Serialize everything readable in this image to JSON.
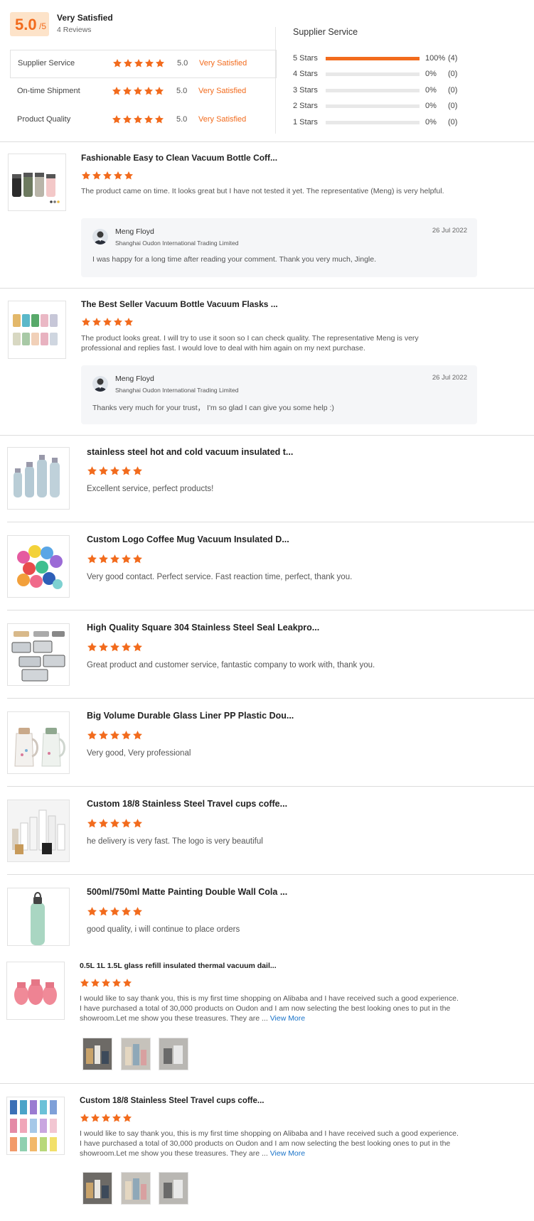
{
  "summary": {
    "score": "5.0",
    "score_max": "/5",
    "overall_label": "Very Satisfied",
    "review_count": "4 Reviews",
    "categories": [
      {
        "label": "Supplier Service",
        "rating": 5,
        "value": "5.0",
        "text": "Very Satisfied"
      },
      {
        "label": "On-time Shipment",
        "rating": 5,
        "value": "5.0",
        "text": "Very Satisfied"
      },
      {
        "label": "Product Quality",
        "rating": 5,
        "value": "5.0",
        "text": "Very Satisfied"
      }
    ],
    "distribution_title": "Supplier Service",
    "distribution": [
      {
        "label": "5 Stars",
        "percent": "100%",
        "count": "(4)",
        "fraction": 1.0
      },
      {
        "label": "4 Stars",
        "percent": "0%",
        "count": "(0)",
        "fraction": 0
      },
      {
        "label": "3 Stars",
        "percent": "0%",
        "count": "(0)",
        "fraction": 0
      },
      {
        "label": "2 Stars",
        "percent": "0%",
        "count": "(0)",
        "fraction": 0
      },
      {
        "label": "1 Stars",
        "percent": "0%",
        "count": "(0)",
        "fraction": 0
      }
    ]
  },
  "reviews": [
    {
      "title": "Fashionable Easy to Clean Vacuum Bottle Coff...",
      "rating": 5,
      "text": "The product came on time. It looks great but I have not tested it yet. The representative (Meng) is very helpful.",
      "reply": {
        "name": "Meng Floyd",
        "company": "Shanghai Oudon International Trading Limited",
        "date": "26 Jul 2022",
        "text": "I was happy for a long time after reading your comment. Thank you very much, Jingle."
      }
    },
    {
      "title": "The Best Seller Vacuum Bottle Vacuum Flasks ...",
      "rating": 5,
      "text": "The product looks great. I will try to use it soon so I can check quality. The representative Meng is very professional and replies fast. I would love to deal with him again on my next purchase.",
      "reply": {
        "name": "Meng Floyd",
        "company": "Shanghai Oudon International Trading Limited",
        "date": "26 Jul 2022",
        "text": "Thanks very much for your trust， I'm so glad I can give you some help :)"
      }
    },
    {
      "title": "stainless steel hot and cold vacuum insulated t...",
      "rating": 5,
      "text": "Excellent service, perfect products!"
    },
    {
      "title": "Custom Logo Coffee Mug Vacuum Insulated D...",
      "rating": 5,
      "text": "Very good contact. Perfect service. Fast reaction time, perfect, thank you."
    },
    {
      "title": "High Quality Square 304 Stainless Steel Seal Leakpro...",
      "rating": 5,
      "text": "Great product and customer service, fantastic company to work with, thank you."
    },
    {
      "title": "Big Volume Durable Glass Liner PP Plastic Dou...",
      "rating": 5,
      "text": "Very good, Very professional"
    },
    {
      "title": "Custom 18/8 Stainless Steel Travel cups coffe...",
      "rating": 5,
      "text": "he delivery is very fast. The logo is very beautiful"
    },
    {
      "title": "500ml/750ml Matte Painting Double Wall Cola ...",
      "rating": 5,
      "text": "good quality, i will continue to place orders"
    },
    {
      "title": "0.5L 1L 1.5L glass refill insulated thermal vacuum dail...",
      "rating": 5,
      "text": "I would like to say thank you, this is my first time shopping on Alibaba and I have received such a good experience. I have purchased a total of 30,000 products on Oudon and I am now selecting the best looking ones to put in the showroom.Let me show you these treasures. They are ...",
      "view_more": "View More"
    },
    {
      "title": "Custom 18/8 Stainless Steel Travel cups coffe...",
      "rating": 5,
      "text": "I would like to say thank you, this is my first time shopping on Alibaba and I have received such a good experience. I have purchased a total of 30,000 products on Oudon and I am now selecting the best looking ones to put in the showroom.Let me show you these treasures. They are ...",
      "view_more": "View More"
    }
  ],
  "colors": {
    "accent": "#f26b1d",
    "link": "#1a73c8"
  }
}
